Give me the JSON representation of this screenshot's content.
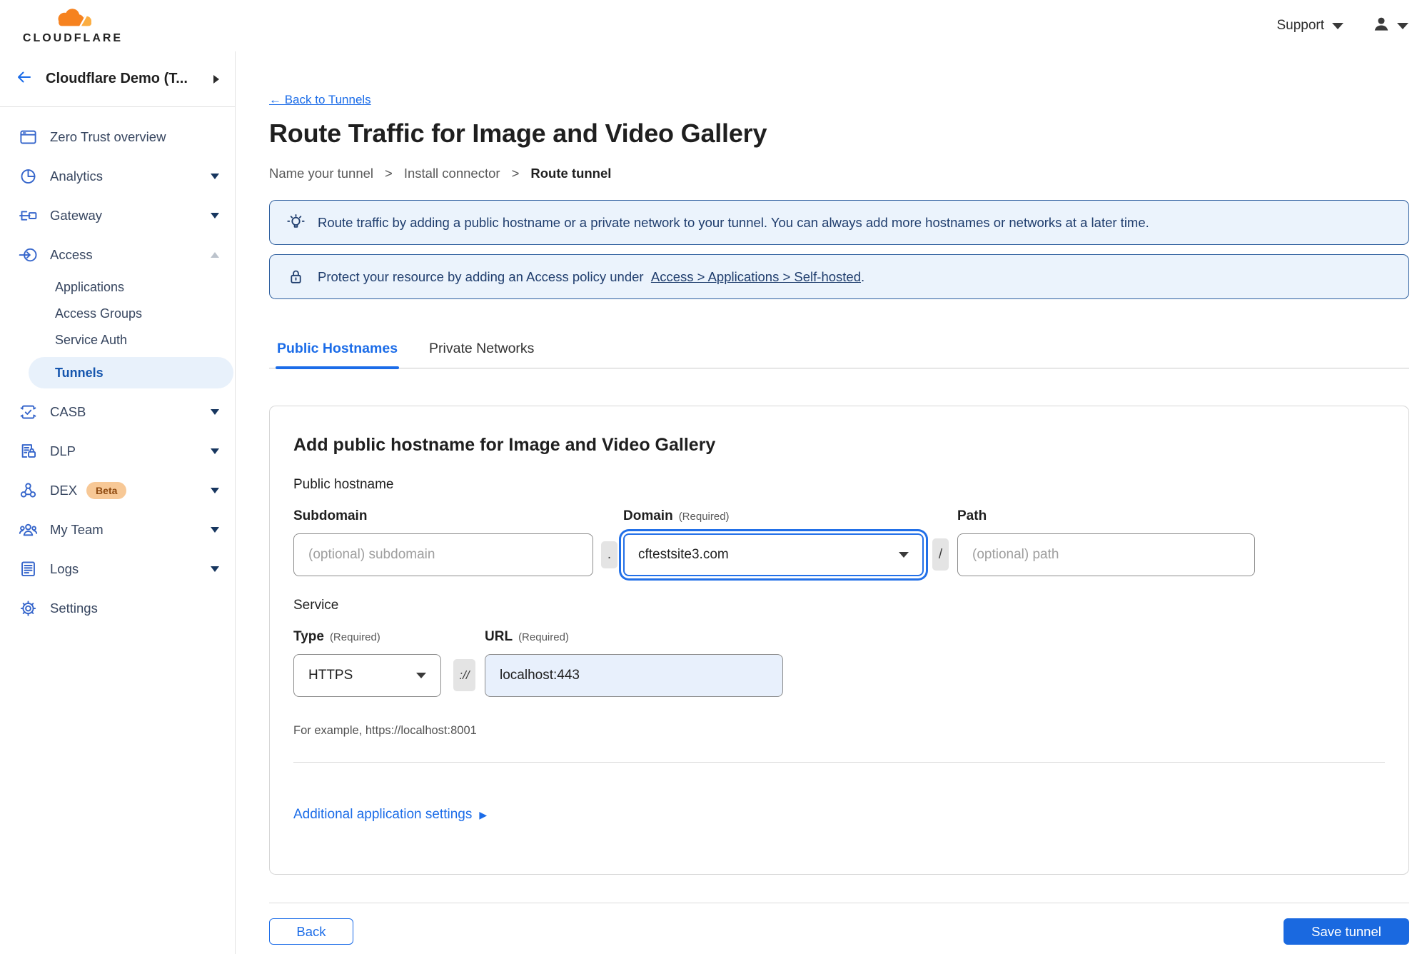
{
  "colors": {
    "accent": "#1B6CE8",
    "save_button": "#1A69E0",
    "banner_bg": "#EBF3FC",
    "banner_border": "#2D5E9E",
    "banner_text": "#1F3D6D",
    "sidebar_icon": "#3565CB",
    "active_item_bg": "#E8F1FB",
    "url_field_bg": "#E8F0FC",
    "logo_orange": "#F6821F",
    "logo_orange_light": "#FBAD41",
    "beta_badge_bg": "#F7C896"
  },
  "topbar": {
    "brand": "CLOUDFLARE",
    "support": "Support"
  },
  "sidebar": {
    "account": "Cloudflare Demo (T...",
    "items": [
      {
        "label": "Zero Trust overview"
      },
      {
        "label": "Analytics"
      },
      {
        "label": "Gateway"
      },
      {
        "label": "Access"
      },
      {
        "label": "CASB"
      },
      {
        "label": "DLP"
      },
      {
        "label": "DEX",
        "badge": "Beta"
      },
      {
        "label": "My Team"
      },
      {
        "label": "Logs"
      },
      {
        "label": "Settings"
      }
    ],
    "access_children": [
      "Applications",
      "Access Groups",
      "Service Auth",
      "Tunnels"
    ]
  },
  "page": {
    "back_link": "← Back to Tunnels",
    "title": "Route Traffic for Image and Video Gallery",
    "breadcrumb": {
      "step1": "Name your tunnel",
      "sep": ">",
      "step2": "Install connector",
      "step3": "Route tunnel"
    },
    "banner_tip": "Route traffic by adding a public hostname or a private network to your tunnel. You can always add more hostnames or networks at a later time.",
    "banner_protect_prefix": "Protect your resource by adding an Access policy under",
    "banner_protect_link": "Access > Applications > Self-hosted",
    "banner_protect_suffix": ".",
    "tabs": {
      "public": "Public Hostnames",
      "private": "Private Networks"
    }
  },
  "form": {
    "heading": "Add public hostname for Image and Video Gallery",
    "section_hostname": "Public hostname",
    "subdomain": {
      "label": "Subdomain",
      "placeholder": "(optional) subdomain"
    },
    "domain": {
      "label": "Domain",
      "required": "(Required)",
      "value": "cftestsite3.com"
    },
    "path": {
      "label": "Path",
      "placeholder": "(optional) path"
    },
    "separators": {
      "dot": ".",
      "slash": "/",
      "protocol": "://"
    },
    "section_service": "Service",
    "type": {
      "label": "Type",
      "required": "(Required)",
      "value": "HTTPS"
    },
    "url": {
      "label": "URL",
      "required": "(Required)",
      "value": "localhost:443"
    },
    "example": "For example, https://localhost:8001",
    "additional_settings": "Additional application settings",
    "expand_icon": "▶"
  },
  "footer": {
    "back": "Back",
    "save": "Save tunnel"
  }
}
